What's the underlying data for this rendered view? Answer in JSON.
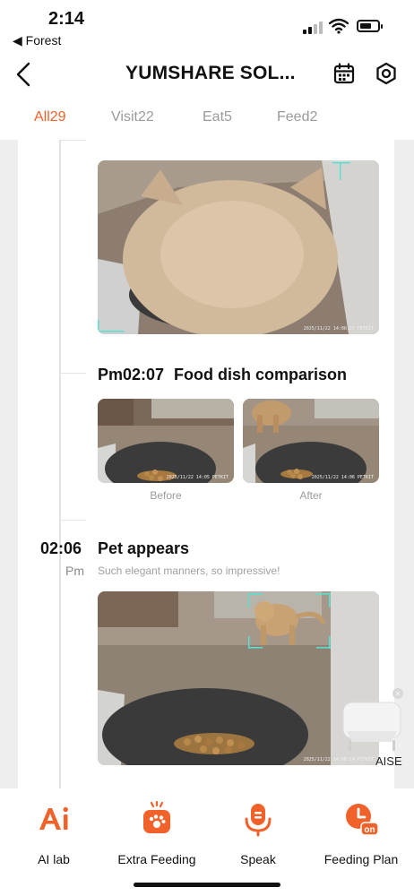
{
  "status": {
    "time": "2:14",
    "back_app": "◀ Forest"
  },
  "nav": {
    "title": "YUMSHARE SOL..."
  },
  "tabs": [
    {
      "label": "All29",
      "active": true
    },
    {
      "label": "Visit22",
      "active": false
    },
    {
      "label": "Eat5",
      "active": false
    },
    {
      "label": "Feed2",
      "active": false
    }
  ],
  "events": {
    "top_stamp": "2025/11/22 14:06:27 PETKIT",
    "comparison": {
      "time": "Pm02:07",
      "title": "Food dish comparison",
      "before_label": "Before",
      "after_label": "After",
      "before_stamp": "2025/11/22 14:05 PETKIT",
      "after_stamp": "2025/11/22 14:06 PETKIT"
    },
    "pet": {
      "time": "02:06",
      "ampm": "Pm",
      "title": "Pet appears",
      "subtitle": "Such elegant manners, so impressive!",
      "stamp": "2025/11/22 14:06:14 PETKIT"
    }
  },
  "float_ad": {
    "text": "AISE"
  },
  "bottom_bar": [
    {
      "label": "AI lab",
      "icon": "ai-icon"
    },
    {
      "label": "Extra Feeding",
      "icon": "extra-feeding-icon"
    },
    {
      "label": "Speak",
      "icon": "microphone-icon"
    },
    {
      "label": "Feeding Plan",
      "icon": "clock-on-icon"
    }
  ],
  "colors": {
    "accent": "#f0622a",
    "muted": "#9a9a9a"
  }
}
